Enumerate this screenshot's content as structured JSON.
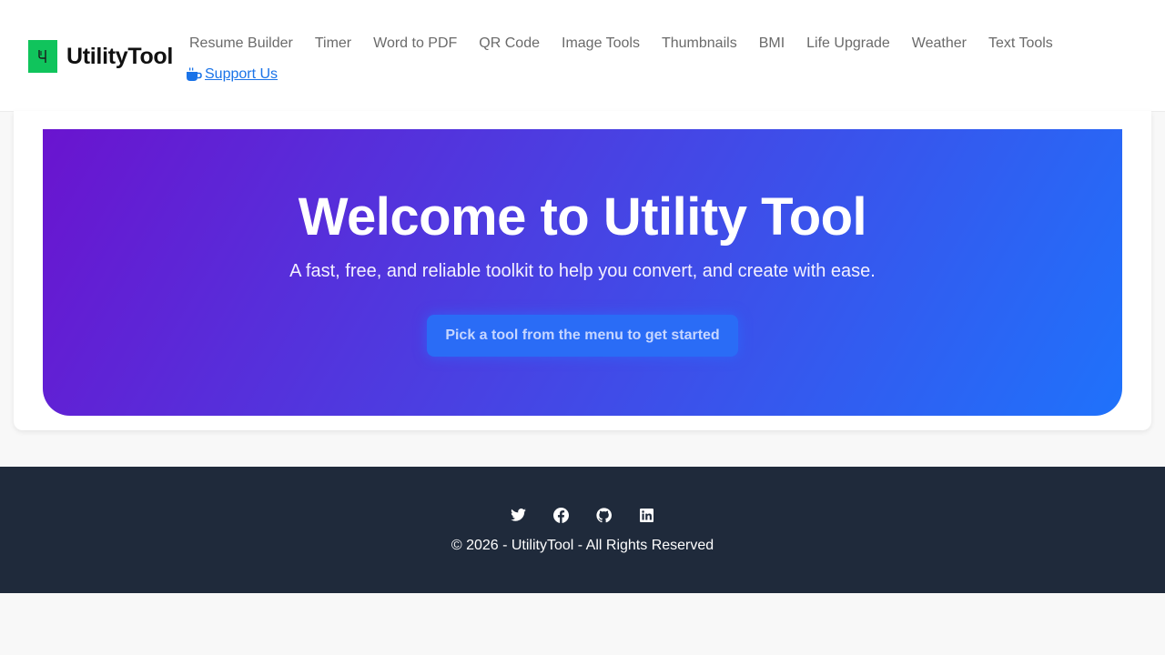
{
  "brand": {
    "name": "UtilityTool",
    "logo_glyph": "Ч",
    "logo_color": "#10c45c"
  },
  "nav": {
    "items": [
      {
        "label": "Resume Builder"
      },
      {
        "label": "Timer"
      },
      {
        "label": "Word to PDF"
      },
      {
        "label": "QR Code"
      },
      {
        "label": "Image Tools"
      },
      {
        "label": "Thumbnails"
      },
      {
        "label": "BMI"
      },
      {
        "label": "Life Upgrade"
      },
      {
        "label": "Weather"
      },
      {
        "label": "Text Tools"
      }
    ],
    "support": {
      "label": " Support Us",
      "icon": "coffee-cup-icon",
      "color": "#1a73e8"
    }
  },
  "hero": {
    "title": "Welcome to Utility Tool",
    "subtitle": "A fast, free, and reliable toolkit to help you convert, and create with ease.",
    "cta_label": "Pick a tool from the menu to get started",
    "gradient": [
      "#6a14cf",
      "#4a40e2",
      "#1f72fb"
    ]
  },
  "footer": {
    "social": [
      {
        "icon": "twitter-icon"
      },
      {
        "icon": "facebook-icon"
      },
      {
        "icon": "github-icon"
      },
      {
        "icon": "linkedin-icon"
      }
    ],
    "copyright": "© 2026 - UtilityTool - All Rights Reserved",
    "background": "#1f2a3b"
  }
}
